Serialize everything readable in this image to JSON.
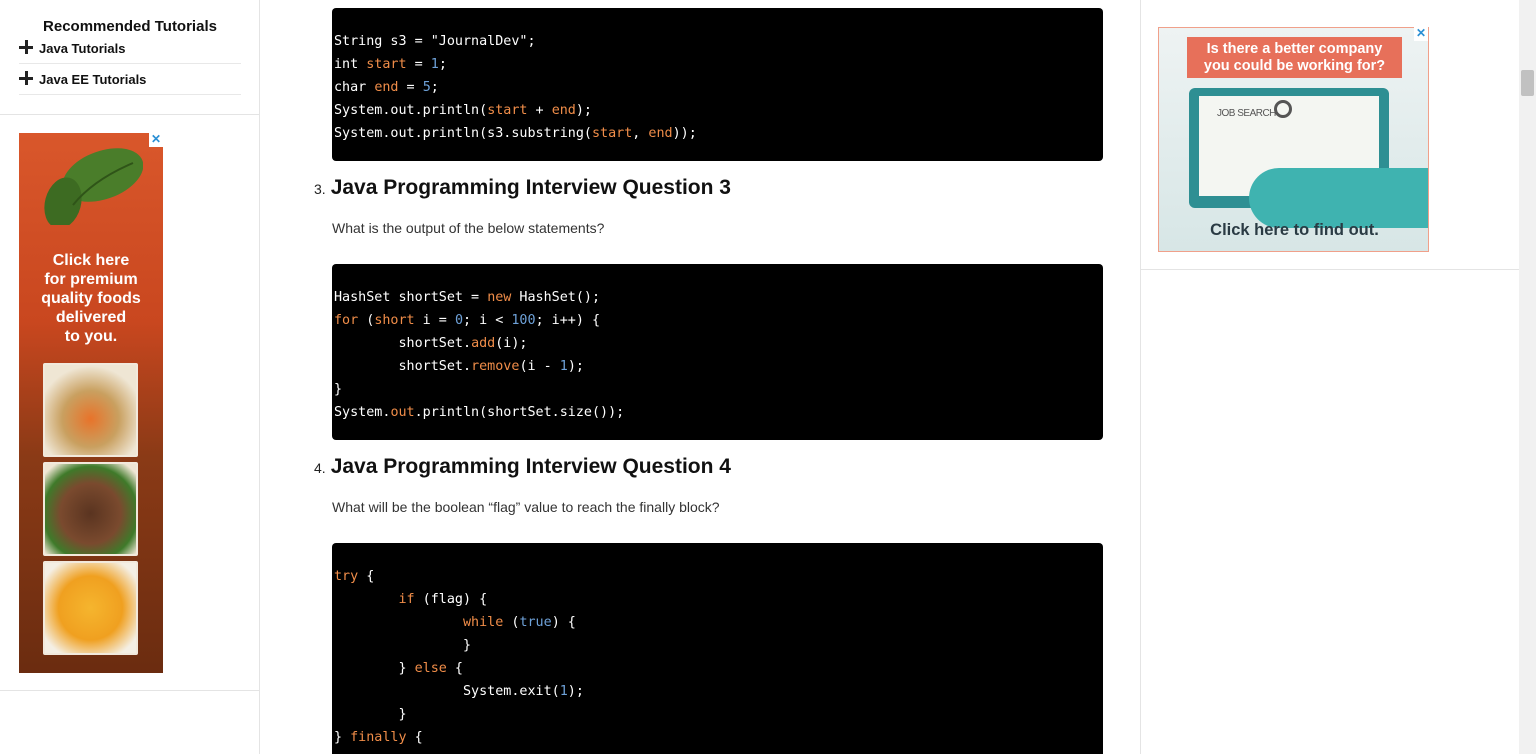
{
  "sidebar": {
    "title": "Recommended Tutorials",
    "items": [
      {
        "label": "Java Tutorials"
      },
      {
        "label": "Java EE Tutorials"
      }
    ]
  },
  "ad_left": {
    "text_lines": [
      "Click here",
      "for premium",
      "quality foods",
      "delivered",
      "to you."
    ],
    "close_icon": "close-icon"
  },
  "ad_right": {
    "headline_lines": [
      "Is there a better company",
      "you could be working for?"
    ],
    "screen_text": "JOB SEARCH",
    "cta": "Click here to find out.",
    "close_icon": "close-icon"
  },
  "code_block_1": {
    "lines": [
      "String s3 = \"JournalDev\";",
      "int start = 1;",
      "char end = 5;",
      "System.out.println(start + end);",
      "System.out.println(s3.substring(start, end));"
    ]
  },
  "question_3": {
    "number": "3.",
    "title": "Java Programming Interview Question 3",
    "text": "What is the output of the below statements?"
  },
  "code_block_2": {
    "lines": [
      "HashSet shortSet = new HashSet();",
      "for (short i = 0; i < 100; i++) {",
      "        shortSet.add(i);",
      "        shortSet.remove(i - 1);",
      "}",
      "System.out.println(shortSet.size());"
    ]
  },
  "question_4": {
    "number": "4.",
    "title": "Java Programming Interview Question 4",
    "text": "What will be the boolean “flag” value to reach the finally block?"
  },
  "code_block_3": {
    "lines": [
      "try {",
      "        if (flag) {",
      "                while (true) {",
      "                }",
      "        } else {",
      "                System.exit(1);",
      "        }",
      "} finally {"
    ]
  },
  "colors": {
    "code_bg": "#000000",
    "keyword": "#f08d49",
    "number": "#6ea1d8",
    "ad_accent": "#e7705a"
  }
}
